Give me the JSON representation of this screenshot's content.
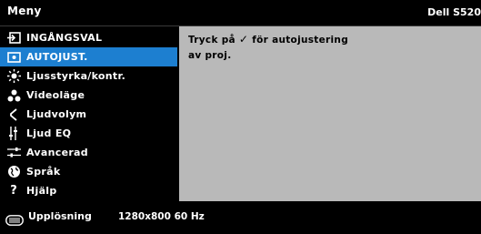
{
  "header": {
    "title": "Meny",
    "model": "Dell S520"
  },
  "menu": {
    "items": [
      {
        "label": "INGÅNGSVAL",
        "icon": "input-icon",
        "selected": false
      },
      {
        "label": "AUTOJUST.",
        "icon": "auto-adjust-icon",
        "selected": true
      },
      {
        "label": "Ljusstyrka/kontr.",
        "icon": "brightness-icon",
        "selected": false
      },
      {
        "label": "Videoläge",
        "icon": "video-mode-icon",
        "selected": false
      },
      {
        "label": "Ljudvolym",
        "icon": "volume-icon",
        "selected": false
      },
      {
        "label": "Ljud EQ",
        "icon": "equalizer-icon",
        "selected": false
      },
      {
        "label": "Avancerad",
        "icon": "advanced-settings-icon",
        "selected": false
      },
      {
        "label": "Språk",
        "icon": "language-icon",
        "selected": false
      },
      {
        "label": "Hjälp",
        "icon": "help-icon",
        "selected": false
      }
    ]
  },
  "panel": {
    "line1_before": "Tryck på",
    "line1_after": "för autojustering",
    "line2": "av proj."
  },
  "footer": {
    "label": "Upplösning",
    "value": "1280x800 60 Hz",
    "icon": "resolution-icon"
  },
  "colors": {
    "selected": "#1d7fd0",
    "panel": "#b9b9b9",
    "background": "#000000"
  }
}
